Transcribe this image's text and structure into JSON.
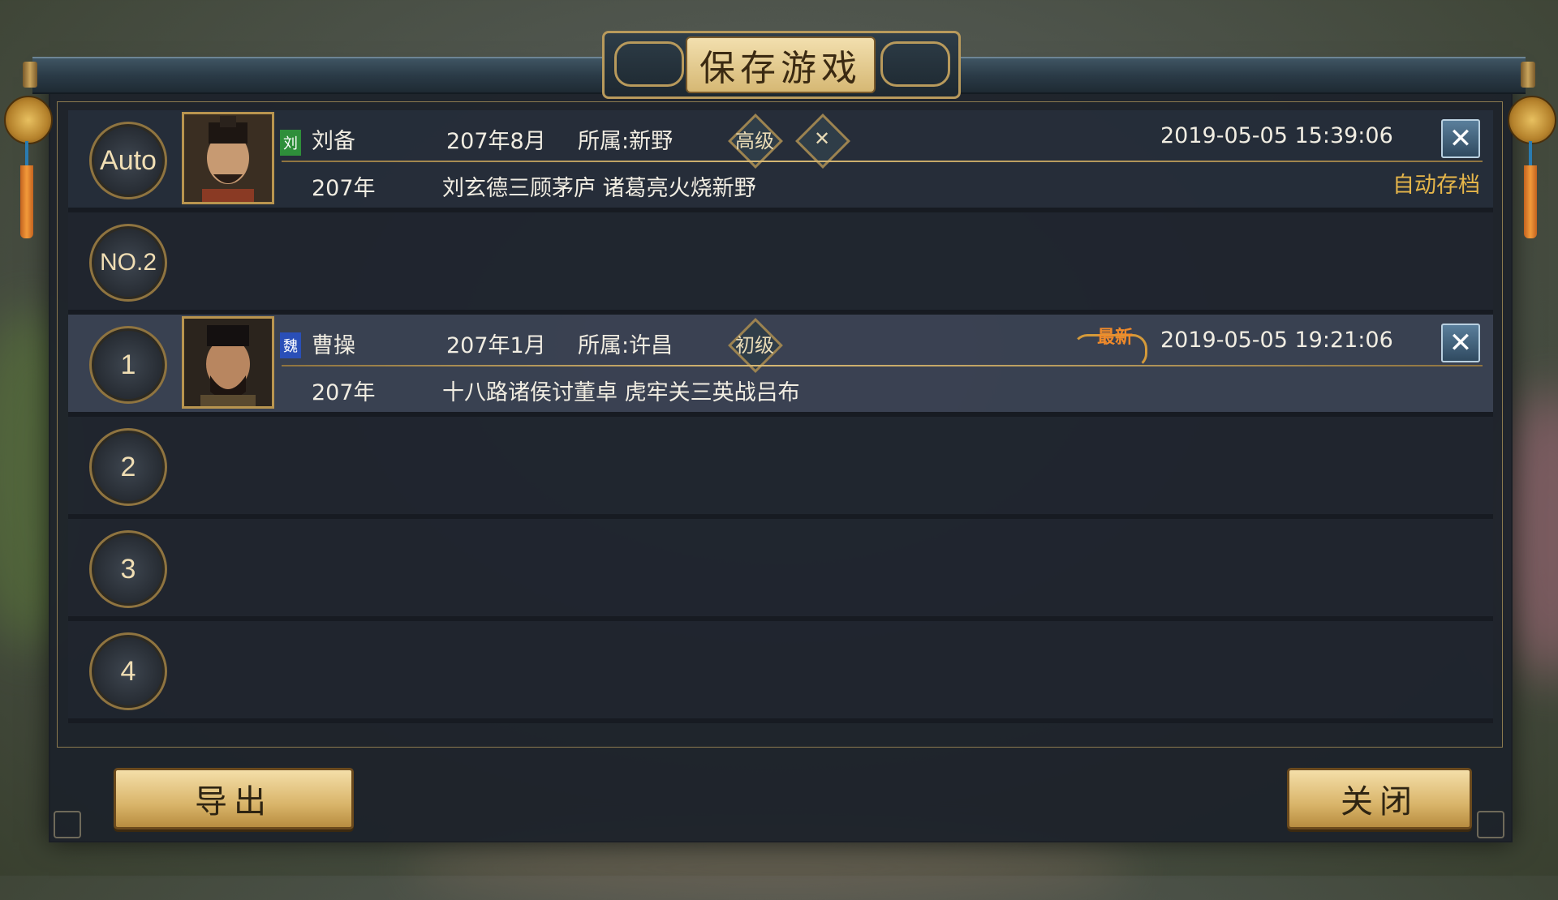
{
  "window": {
    "title": "保存游戏"
  },
  "slots": [
    {
      "badge": "Auto",
      "name": "刘备",
      "faction_char": "刘",
      "faction_color": "#2e8f3a",
      "date": "207年8月",
      "location": "所属:新野",
      "difficulty": "高级",
      "extra_icon": "crossed-swords-icon",
      "timestamp": "2019-05-05   15:39:06",
      "year": "207年",
      "scenario": "刘玄德三顾茅庐 诸葛亮火烧新野",
      "tag": "自动存档",
      "filled": true
    },
    {
      "badge": "NO.2",
      "filled": false
    },
    {
      "badge": "1",
      "name": "曹操",
      "faction_char": "魏",
      "faction_color": "#2a4fb8",
      "date": "207年1月",
      "location": "所属:许昌",
      "difficulty": "初级",
      "timestamp": "2019-05-05   19:21:06",
      "year": "207年",
      "scenario": "十八路诸侯讨董卓 虎牢关三英战吕布",
      "latest_label": "最新",
      "filled": true
    },
    {
      "badge": "2",
      "filled": false
    },
    {
      "badge": "3",
      "filled": false
    },
    {
      "badge": "4",
      "filled": false
    }
  ],
  "buttons": {
    "export": "导出",
    "close": "关闭"
  },
  "icons": {
    "close": "close-icon"
  }
}
